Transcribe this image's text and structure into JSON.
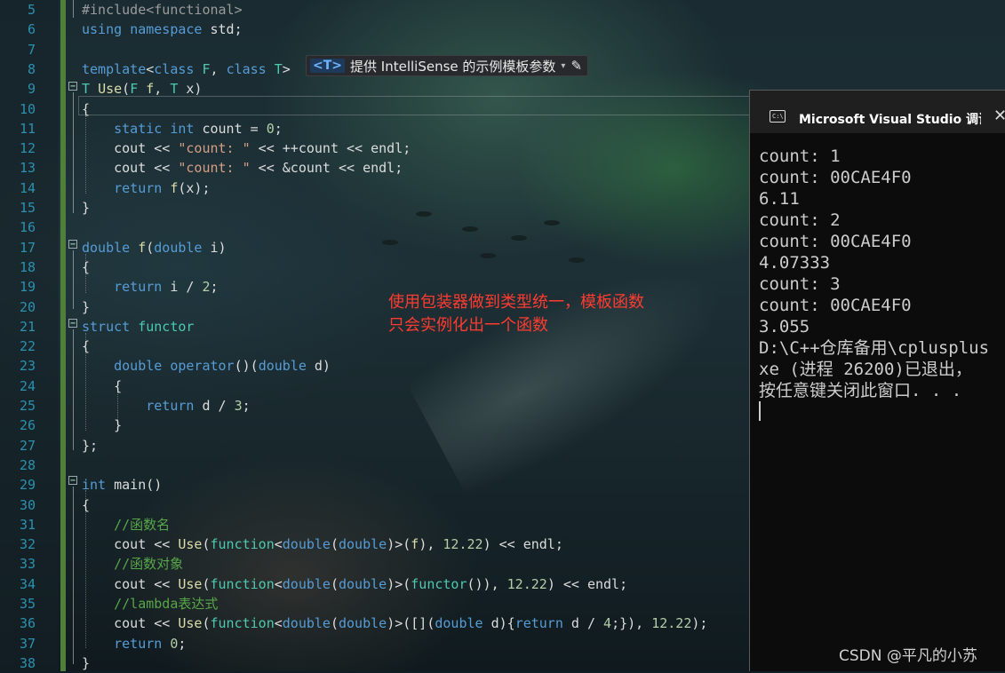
{
  "editor": {
    "line_numbers": [
      "5",
      "6",
      "7",
      "8",
      "9",
      "10",
      "11",
      "12",
      "13",
      "14",
      "15",
      "16",
      "17",
      "18",
      "19",
      "20",
      "21",
      "22",
      "23",
      "24",
      "25",
      "26",
      "27",
      "28",
      "29",
      "30",
      "31",
      "32",
      "33",
      "34",
      "35",
      "36",
      "37",
      "38"
    ],
    "lines": [
      "#include<functional>",
      "using namespace std;",
      "",
      "template<class F, class T>",
      "T Use(F f, T x)",
      "{",
      "    static int count = 0;",
      "    cout << \"count: \" << ++count << endl;",
      "    cout << \"count: \" << &count << endl;",
      "    return f(x);",
      "}",
      "",
      "double f(double i)",
      "{",
      "    return i / 2;",
      "}",
      "struct functor",
      "{",
      "    double operator()(double d)",
      "    {",
      "        return d / 3;",
      "    }",
      "};",
      "",
      "int main()",
      "{",
      "    //函数名",
      "    cout << Use(function<double(double)>(f), 12.22) << endl;",
      "    //函数对象",
      "    cout << Use(function<double(double)>(functor()), 12.22) << endl;",
      "    //lambda表达式",
      "    cout << Use(function<double(double)>([](double d){return d / 4;}), 12.22);",
      "    return 0;",
      "}"
    ]
  },
  "intellisense_hint": {
    "badge": "<T>",
    "text": "提供 IntelliSense 的示例模板参数",
    "dropdown_glyph": "▾",
    "edit_glyph": "✎"
  },
  "annotation": {
    "line1": "使用包装器做到类型统一，模板函数",
    "line2": "只会实例化出一个函数"
  },
  "console": {
    "title": "Microsoft Visual Studio 调试控制台",
    "icon_text": "C:\\",
    "close_glyph": "✕",
    "output": [
      "count: 1",
      "count: 00CAE4F0",
      "6.11",
      "count: 2",
      "count: 00CAE4F0",
      "4.07333",
      "count: 3",
      "count: 00CAE4F0",
      "3.055",
      "D:\\C++仓库备用\\cplusplus",
      "xe (进程 26200)已退出，",
      "按任意键关闭此窗口. . ."
    ]
  },
  "watermark": "CSDN @平凡的小苏",
  "colors": {
    "keyword": "#569cd6",
    "type": "#4ec9b0",
    "string": "#d69d85",
    "comment": "#57a64a",
    "function": "#dcdcaa",
    "number": "#b5cea8",
    "line_number": "#2b91af",
    "annotation": "#ff3b2f"
  }
}
